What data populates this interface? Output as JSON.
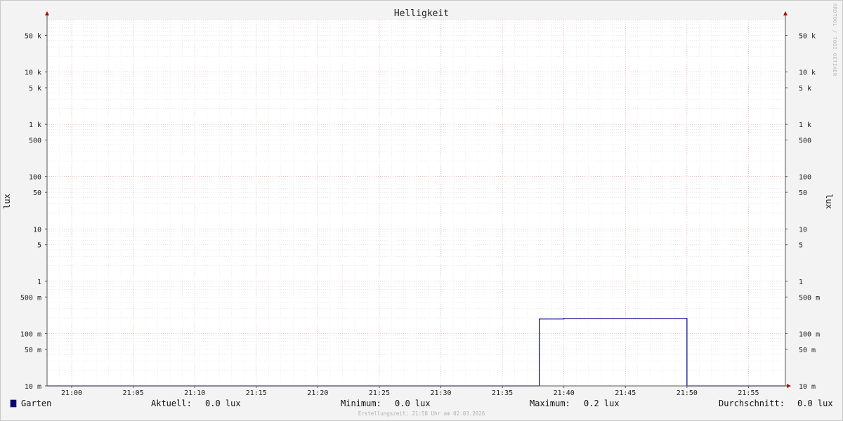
{
  "chart_data": {
    "type": "line",
    "title": "Helligkeit",
    "ylabel": "lux",
    "yscale": "log",
    "ylim": [
      0.01,
      100000
    ],
    "xlim": [
      "20:58",
      "21:58"
    ],
    "x_ticks": [
      "21:00",
      "21:05",
      "21:10",
      "21:15",
      "21:20",
      "21:25",
      "21:30",
      "21:35",
      "21:40",
      "21:45",
      "21:50",
      "21:55"
    ],
    "y_ticks": [
      {
        "value": 50000,
        "label": "50 k"
      },
      {
        "value": 10000,
        "label": "10 k"
      },
      {
        "value": 5000,
        "label": "5 k"
      },
      {
        "value": 1000,
        "label": "1 k"
      },
      {
        "value": 500,
        "label": "500"
      },
      {
        "value": 100,
        "label": "100"
      },
      {
        "value": 50,
        "label": "50"
      },
      {
        "value": 10,
        "label": "10"
      },
      {
        "value": 5,
        "label": "5"
      },
      {
        "value": 1,
        "label": "1"
      },
      {
        "value": 0.5,
        "label": "500 m"
      },
      {
        "value": 0.1,
        "label": "100 m"
      },
      {
        "value": 0.05,
        "label": "50 m"
      },
      {
        "value": 0.01,
        "label": "10 m"
      }
    ],
    "grid": true,
    "series": [
      {
        "name": "Garten",
        "color": "#00008b",
        "points": [
          {
            "x": "21:38",
            "y": 0.19
          },
          {
            "x": "21:40",
            "y": 0.195
          },
          {
            "x": "21:50",
            "y": 0.195
          }
        ]
      }
    ],
    "legend": {
      "swatch_color": "#00008b",
      "name": "Garten",
      "stats": [
        {
          "label": "Aktuell:",
          "value": "0.0 lux"
        },
        {
          "label": "Minimum:",
          "value": "0.0 lux"
        },
        {
          "label": "Maximum:",
          "value": "0.2 lux"
        },
        {
          "label": "Durchschnitt:",
          "value": "0.0 lux"
        }
      ]
    },
    "watermark": "RRDTOOL / TOBI OETIKER",
    "footer": "Erstellungszeit: 21:58 Uhr am 02.03.2026"
  }
}
